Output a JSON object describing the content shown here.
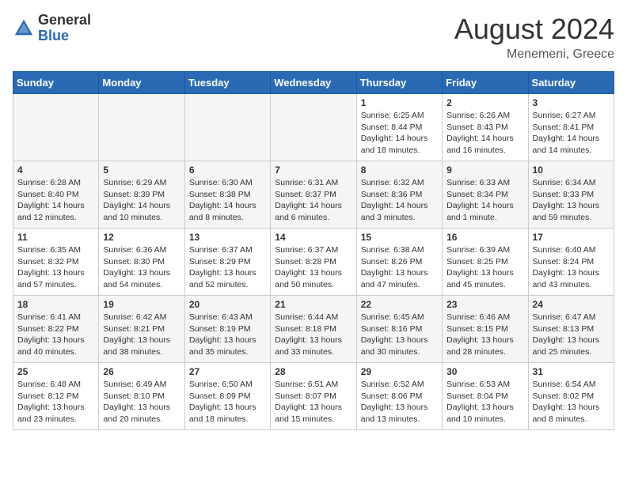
{
  "header": {
    "logo_general": "General",
    "logo_blue": "Blue",
    "month_year": "August 2024",
    "location": "Menemeni, Greece"
  },
  "days_of_week": [
    "Sunday",
    "Monday",
    "Tuesday",
    "Wednesday",
    "Thursday",
    "Friday",
    "Saturday"
  ],
  "weeks": [
    [
      {
        "day": "",
        "info": ""
      },
      {
        "day": "",
        "info": ""
      },
      {
        "day": "",
        "info": ""
      },
      {
        "day": "",
        "info": ""
      },
      {
        "day": "1",
        "info": "Sunrise: 6:25 AM\nSunset: 8:44 PM\nDaylight: 14 hours\nand 18 minutes."
      },
      {
        "day": "2",
        "info": "Sunrise: 6:26 AM\nSunset: 8:43 PM\nDaylight: 14 hours\nand 16 minutes."
      },
      {
        "day": "3",
        "info": "Sunrise: 6:27 AM\nSunset: 8:41 PM\nDaylight: 14 hours\nand 14 minutes."
      }
    ],
    [
      {
        "day": "4",
        "info": "Sunrise: 6:28 AM\nSunset: 8:40 PM\nDaylight: 14 hours\nand 12 minutes."
      },
      {
        "day": "5",
        "info": "Sunrise: 6:29 AM\nSunset: 8:39 PM\nDaylight: 14 hours\nand 10 minutes."
      },
      {
        "day": "6",
        "info": "Sunrise: 6:30 AM\nSunset: 8:38 PM\nDaylight: 14 hours\nand 8 minutes."
      },
      {
        "day": "7",
        "info": "Sunrise: 6:31 AM\nSunset: 8:37 PM\nDaylight: 14 hours\nand 6 minutes."
      },
      {
        "day": "8",
        "info": "Sunrise: 6:32 AM\nSunset: 8:36 PM\nDaylight: 14 hours\nand 3 minutes."
      },
      {
        "day": "9",
        "info": "Sunrise: 6:33 AM\nSunset: 8:34 PM\nDaylight: 14 hours\nand 1 minute."
      },
      {
        "day": "10",
        "info": "Sunrise: 6:34 AM\nSunset: 8:33 PM\nDaylight: 13 hours\nand 59 minutes."
      }
    ],
    [
      {
        "day": "11",
        "info": "Sunrise: 6:35 AM\nSunset: 8:32 PM\nDaylight: 13 hours\nand 57 minutes."
      },
      {
        "day": "12",
        "info": "Sunrise: 6:36 AM\nSunset: 8:30 PM\nDaylight: 13 hours\nand 54 minutes."
      },
      {
        "day": "13",
        "info": "Sunrise: 6:37 AM\nSunset: 8:29 PM\nDaylight: 13 hours\nand 52 minutes."
      },
      {
        "day": "14",
        "info": "Sunrise: 6:37 AM\nSunset: 8:28 PM\nDaylight: 13 hours\nand 50 minutes."
      },
      {
        "day": "15",
        "info": "Sunrise: 6:38 AM\nSunset: 8:26 PM\nDaylight: 13 hours\nand 47 minutes."
      },
      {
        "day": "16",
        "info": "Sunrise: 6:39 AM\nSunset: 8:25 PM\nDaylight: 13 hours\nand 45 minutes."
      },
      {
        "day": "17",
        "info": "Sunrise: 6:40 AM\nSunset: 8:24 PM\nDaylight: 13 hours\nand 43 minutes."
      }
    ],
    [
      {
        "day": "18",
        "info": "Sunrise: 6:41 AM\nSunset: 8:22 PM\nDaylight: 13 hours\nand 40 minutes."
      },
      {
        "day": "19",
        "info": "Sunrise: 6:42 AM\nSunset: 8:21 PM\nDaylight: 13 hours\nand 38 minutes."
      },
      {
        "day": "20",
        "info": "Sunrise: 6:43 AM\nSunset: 8:19 PM\nDaylight: 13 hours\nand 35 minutes."
      },
      {
        "day": "21",
        "info": "Sunrise: 6:44 AM\nSunset: 8:18 PM\nDaylight: 13 hours\nand 33 minutes."
      },
      {
        "day": "22",
        "info": "Sunrise: 6:45 AM\nSunset: 8:16 PM\nDaylight: 13 hours\nand 30 minutes."
      },
      {
        "day": "23",
        "info": "Sunrise: 6:46 AM\nSunset: 8:15 PM\nDaylight: 13 hours\nand 28 minutes."
      },
      {
        "day": "24",
        "info": "Sunrise: 6:47 AM\nSunset: 8:13 PM\nDaylight: 13 hours\nand 25 minutes."
      }
    ],
    [
      {
        "day": "25",
        "info": "Sunrise: 6:48 AM\nSunset: 8:12 PM\nDaylight: 13 hours\nand 23 minutes."
      },
      {
        "day": "26",
        "info": "Sunrise: 6:49 AM\nSunset: 8:10 PM\nDaylight: 13 hours\nand 20 minutes."
      },
      {
        "day": "27",
        "info": "Sunrise: 6:50 AM\nSunset: 8:09 PM\nDaylight: 13 hours\nand 18 minutes."
      },
      {
        "day": "28",
        "info": "Sunrise: 6:51 AM\nSunset: 8:07 PM\nDaylight: 13 hours\nand 15 minutes."
      },
      {
        "day": "29",
        "info": "Sunrise: 6:52 AM\nSunset: 8:06 PM\nDaylight: 13 hours\nand 13 minutes."
      },
      {
        "day": "30",
        "info": "Sunrise: 6:53 AM\nSunset: 8:04 PM\nDaylight: 13 hours\nand 10 minutes."
      },
      {
        "day": "31",
        "info": "Sunrise: 6:54 AM\nSunset: 8:02 PM\nDaylight: 13 hours\nand 8 minutes."
      }
    ]
  ]
}
